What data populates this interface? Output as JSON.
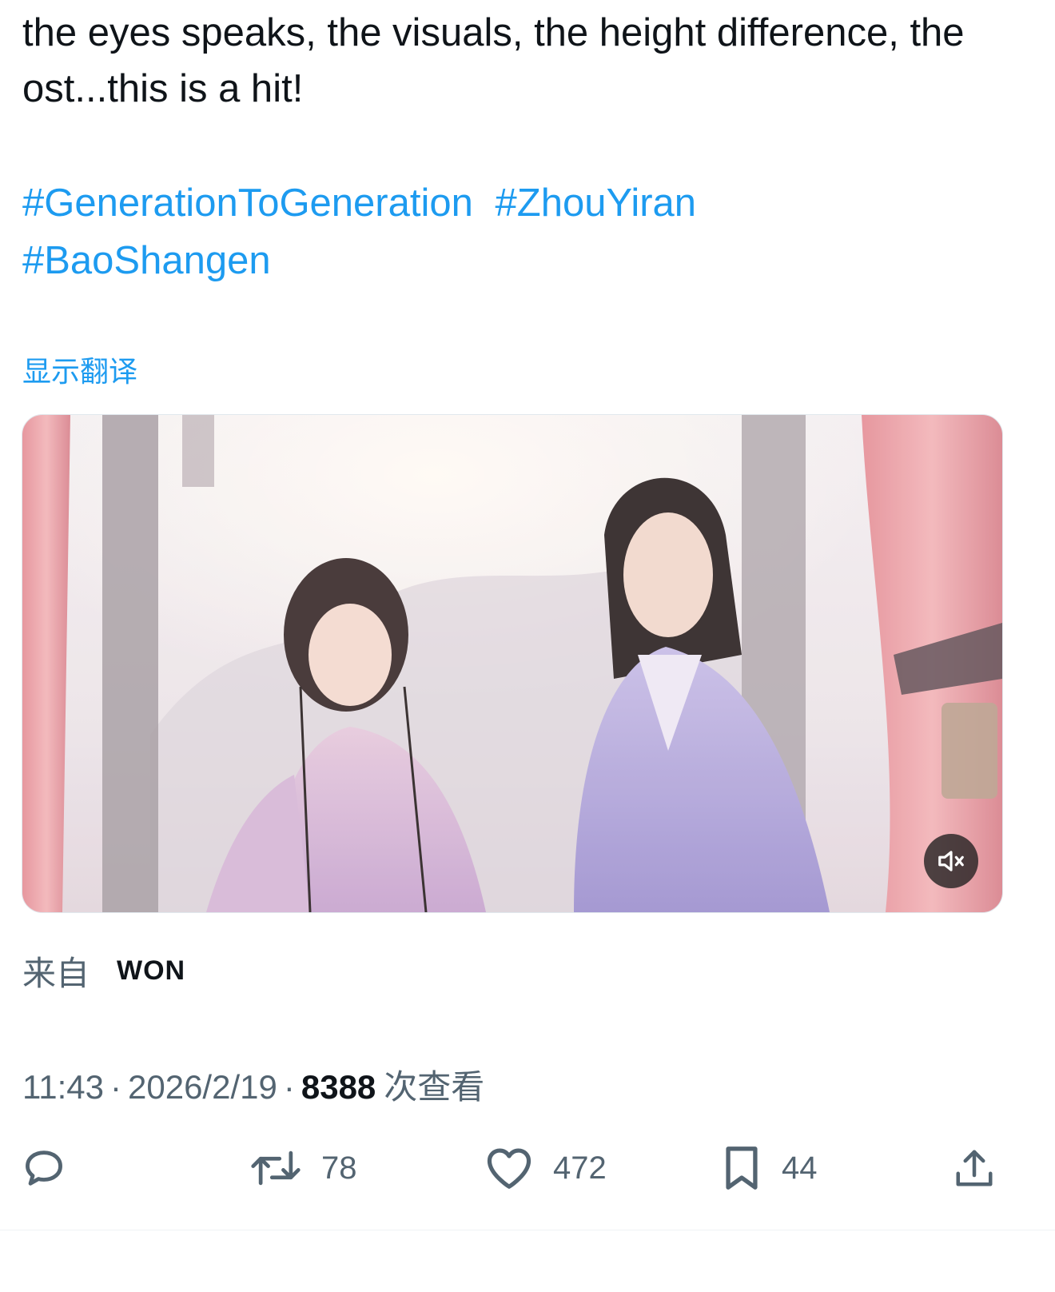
{
  "tweet": {
    "text": "the eyes speaks, the visuals, the height difference, the ost...this is a hit!",
    "hashtags": [
      "#GenerationToGeneration",
      "#ZhouYiran",
      "#BaoShangen"
    ],
    "translate_label": "显示翻译"
  },
  "media": {
    "type": "video",
    "mute_icon": "speaker-muted-icon"
  },
  "source": {
    "prefix": "来自",
    "name": "WON"
  },
  "meta": {
    "time": "11:43",
    "separator": "·",
    "date": "2026/2/19",
    "views_count": "8388",
    "views_label": "次查看"
  },
  "actions": {
    "reply": {
      "icon": "reply-icon",
      "count": ""
    },
    "retweet": {
      "icon": "retweet-icon",
      "count": "78"
    },
    "like": {
      "icon": "heart-icon",
      "count": "472"
    },
    "bookmark": {
      "icon": "bookmark-icon",
      "count": "44"
    },
    "share": {
      "icon": "share-icon"
    }
  },
  "colors": {
    "link": "#1d9bf0",
    "text": "#0f1419",
    "secondary": "#536471"
  }
}
